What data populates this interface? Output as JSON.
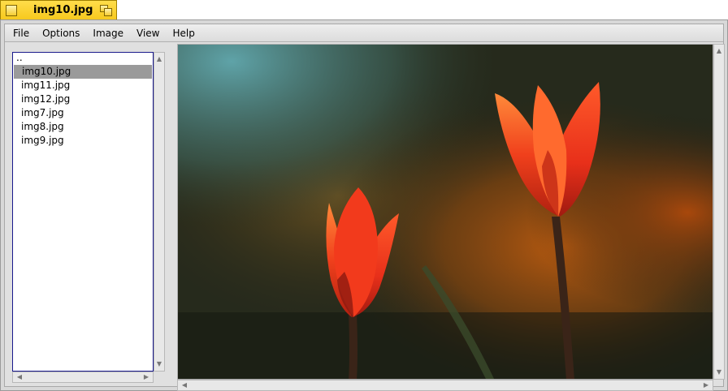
{
  "window": {
    "title": "img10.jpg"
  },
  "menu": [
    "File",
    "Options",
    "Image",
    "View",
    "Help"
  ],
  "file_list": {
    "parent": "..",
    "items": [
      "img10.jpg",
      "img11.jpg",
      "img12.jpg",
      "img7.jpg",
      "img8.jpg",
      "img9.jpg"
    ],
    "selected": "img10.jpg"
  },
  "image": {
    "subject": "two red tulips against a blurred green and orange background"
  },
  "icons": {
    "close": "close-box-icon",
    "zoom": "zoom-box-icon",
    "arrows": [
      "arrow-up-icon",
      "arrow-down-icon",
      "arrow-left-icon",
      "arrow-right-icon"
    ]
  },
  "colors": {
    "tab": "#f6c81c",
    "selection": "#9a9a9a",
    "list_border": "#1a1a8c"
  }
}
